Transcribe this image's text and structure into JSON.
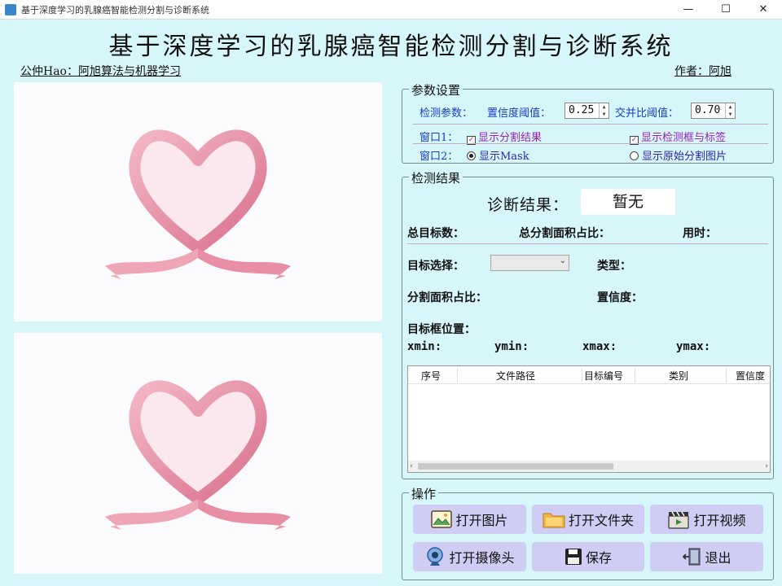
{
  "window": {
    "title": "基于深度学习的乳腺癌智能检测分割与诊断系统",
    "minimize": "—",
    "maximize": "☐",
    "close": "✕"
  },
  "header": {
    "title": "基于深度学习的乳腺癌智能检测分割与诊断系统",
    "left_link": "公仲Hao：阿旭算法与机器学习",
    "right_link": "作者：阿旭"
  },
  "params": {
    "group_title": "参数设置",
    "detect_label": "检测参数：",
    "conf_label": "置信度阈值：",
    "conf_value": "0.25",
    "iou_label": "交并比阈值：",
    "iou_value": "0.70",
    "window1_label": "窗口1：",
    "show_seg": "显示分割结果",
    "show_box": "显示检测框与标签",
    "window2_label": "窗口2：",
    "show_mask": "显示Mask",
    "show_orig": "显示原始分割图片"
  },
  "results": {
    "group_title": "检测结果",
    "diagnosis_label": "诊断结果：",
    "diagnosis_value": "暂无",
    "total_targets": "总目标数：",
    "total_area": "总分割面积占比：",
    "time_used": "用时：",
    "target_select": "目标选择：",
    "type_label": "类型：",
    "area_ratio": "分割面积占比：",
    "confidence": "置信度：",
    "box_pos": "目标框位置：",
    "xmin": "xmin:",
    "ymin": "ymin:",
    "xmax": "xmax:",
    "ymax": "ymax:"
  },
  "table": {
    "columns": [
      "序号",
      "文件路径",
      "目标编号",
      "类别",
      "置信度"
    ],
    "left_arrow": "‹",
    "right_arrow": "›"
  },
  "actions": {
    "group_title": "操作",
    "open_image": "打开图片",
    "open_folder": "打开文件夹",
    "open_video": "打开视频",
    "open_camera": "打开摄像头",
    "save": "保存",
    "exit": "退出"
  }
}
